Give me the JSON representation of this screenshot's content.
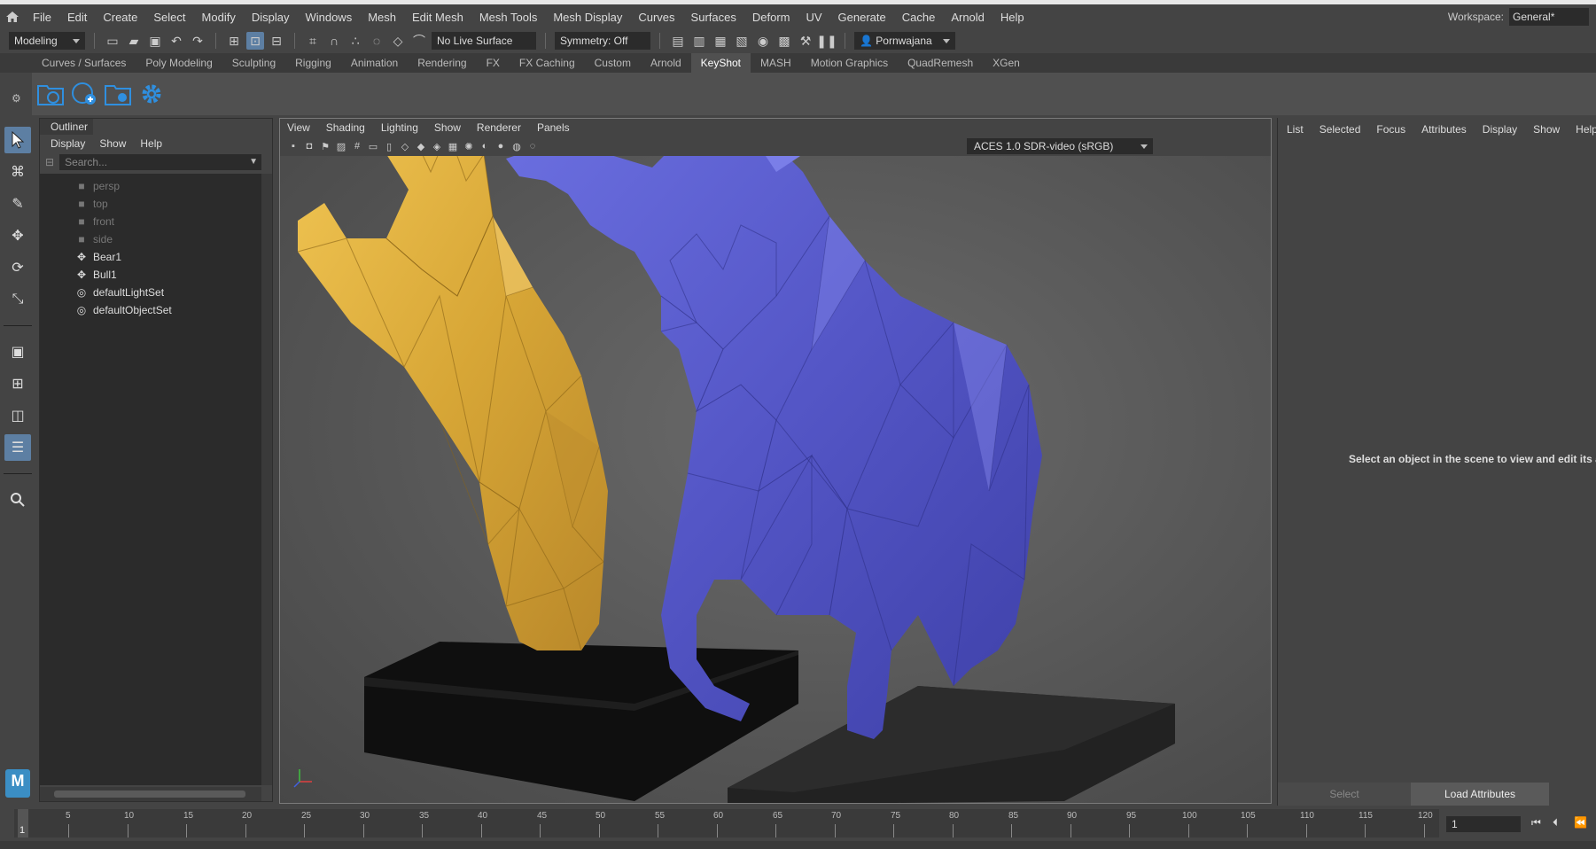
{
  "menubar": {
    "items": [
      "File",
      "Edit",
      "Create",
      "Select",
      "Modify",
      "Display",
      "Windows",
      "Mesh",
      "Edit Mesh",
      "Mesh Tools",
      "Mesh Display",
      "Curves",
      "Surfaces",
      "Deform",
      "UV",
      "Generate",
      "Cache",
      "Arnold",
      "Help"
    ],
    "workspace_label": "Workspace:",
    "workspace_value": "General*"
  },
  "statusline": {
    "mode": "Modeling",
    "live_surface": "No Live Surface",
    "symmetry": "Symmetry: Off",
    "user": "Pornwajana Ti..."
  },
  "shelf": {
    "tabs": [
      "Curves / Surfaces",
      "Poly Modeling",
      "Sculpting",
      "Rigging",
      "Animation",
      "Rendering",
      "FX",
      "FX Caching",
      "Custom",
      "Arnold",
      "KeyShot",
      "MASH",
      "Motion Graphics",
      "QuadRemesh",
      "XGen"
    ],
    "active_tab": "KeyShot"
  },
  "outliner": {
    "title": "Outliner",
    "menu": [
      "Display",
      "Show",
      "Help"
    ],
    "search_placeholder": "Search...",
    "items": [
      {
        "label": "persp",
        "icon": "camera-icon",
        "dim": true
      },
      {
        "label": "top",
        "icon": "camera-icon",
        "dim": true
      },
      {
        "label": "front",
        "icon": "camera-icon",
        "dim": true
      },
      {
        "label": "side",
        "icon": "camera-icon",
        "dim": true
      },
      {
        "label": "Bear1",
        "icon": "transform-icon",
        "dim": false
      },
      {
        "label": "Bull1",
        "icon": "transform-icon",
        "dim": false
      },
      {
        "label": "defaultLightSet",
        "icon": "set-icon",
        "dim": false
      },
      {
        "label": "defaultObjectSet",
        "icon": "set-icon",
        "dim": false
      }
    ]
  },
  "viewport": {
    "menu": [
      "View",
      "Shading",
      "Lighting",
      "Show",
      "Renderer",
      "Panels"
    ],
    "colorspace": "ACES 1.0 SDR-video (sRGB)",
    "colors": {
      "bear": "#d9a93a",
      "bull": "#5658c8",
      "base": "#1a1a1a"
    }
  },
  "attribute_editor": {
    "menu": [
      "List",
      "Selected",
      "Focus",
      "Attributes",
      "Display",
      "Show",
      "Help"
    ],
    "message": "Select an object in the scene to view and edit its attrib",
    "select_button": "Select",
    "load_button": "Load Attributes"
  },
  "timeline": {
    "current_frame": "1",
    "labels": [
      "5",
      "10",
      "15",
      "20",
      "25",
      "30",
      "35",
      "40",
      "45",
      "50",
      "55",
      "60",
      "65",
      "70",
      "75",
      "80",
      "85",
      "90",
      "95",
      "100",
      "105",
      "110",
      "115",
      "120"
    ],
    "frame_field": "1"
  },
  "logo": "M"
}
